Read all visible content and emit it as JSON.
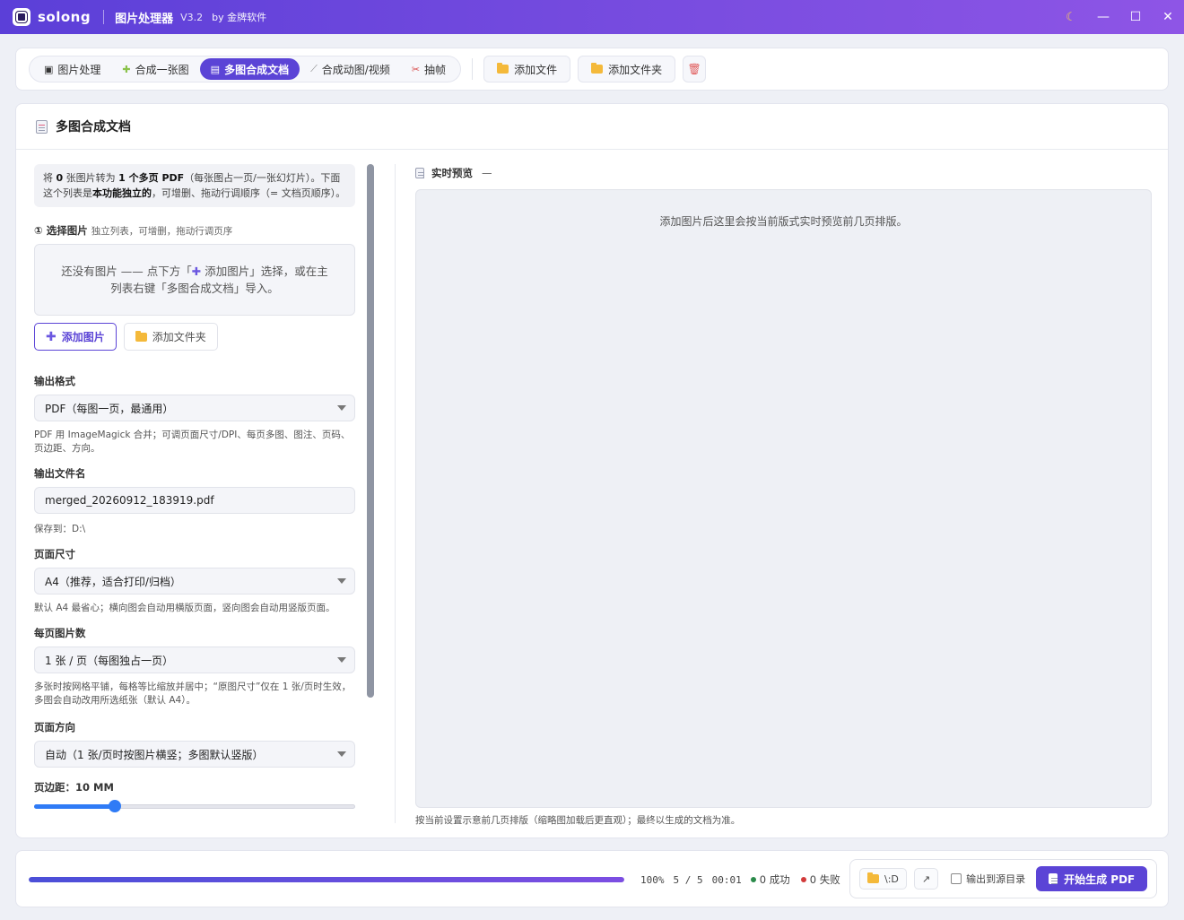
{
  "app": {
    "name": "solong",
    "title": "图片处理器",
    "version": "V3.2",
    "by": "by 金牌软件",
    "theme_icon": "moon-icon",
    "accent_color": "#5b44d6"
  },
  "window": {
    "minimize": "—",
    "maximize": "☐",
    "close": "✕"
  },
  "toolbar": {
    "tabs": [
      {
        "label": "图片处理",
        "icon": "image-icon",
        "glyph": "▣",
        "active": false
      },
      {
        "label": "合成一张图",
        "icon": "puzzle-icon",
        "glyph": "✚",
        "active": false
      },
      {
        "label": "多图合成文档",
        "icon": "document-icon",
        "glyph": "▤",
        "active": true
      },
      {
        "label": "合成动图/视频",
        "icon": "link-icon",
        "glyph": "⟋",
        "active": false
      },
      {
        "label": "抽帧",
        "icon": "scissors-icon",
        "glyph": "✂",
        "active": false
      }
    ],
    "add_file": "添加文件",
    "add_folder": "添加文件夹",
    "trash_glyph": "🗑"
  },
  "main": {
    "title": "多图合成文档",
    "info": {
      "p1": "将 ",
      "count_images": "0",
      "p2": " 张图片转为 ",
      "count_pdf": "1 个多页 PDF",
      "p3": "（每张图占一页/一张幻灯片）。下面这个列表是",
      "emph": "本功能独立的",
      "p4": "，可增删、拖动行调顺序（= 文档页顺序）。"
    },
    "select_images": {
      "title": "① 选择图片",
      "subtitle": "独立列表，可增删，拖动行调页序",
      "empty_text_1": "还没有图片 —— 点下方「",
      "empty_plus": "✚",
      "empty_text_2": " 添加图片」选择，或在主列表右键「多图合成文档」导入。",
      "add_images": "添加图片",
      "add_folder": "添加文件夹"
    },
    "output_format": {
      "label": "输出格式",
      "value": "PDF（每图一页，最通用）",
      "hint": "PDF 用 ImageMagick 合并；可调页面尺寸/DPI、每页多图、图注、页码、页边距、方向。"
    },
    "output_filename": {
      "label": "输出文件名",
      "value": "merged_20260912_183919.pdf",
      "save_to": "保存到：D:\\"
    },
    "page_size": {
      "label": "页面尺寸",
      "value": "A4（推荐，适合打印/归档）",
      "hint": "默认 A4 最省心；横向图会自动用横版页面，竖向图会自动用竖版页面。"
    },
    "images_per_page": {
      "label": "每页图片数",
      "value": "1 张 / 页（每图独占一页）",
      "hint": "多张时按网格平铺，每格等比缩放并居中；“原图尺寸”仅在 1 张/页时生效，多图会自动改用所选纸张（默认 A4）。"
    },
    "orientation": {
      "label": "页面方向",
      "value": "自动（1 张/页时按图片横竖；多图默认竖版）"
    },
    "margin": {
      "label": "页边距：",
      "value_text": "10 MM",
      "value": 10,
      "max": 40
    },
    "preview": {
      "title": "实时预览",
      "dash": "—",
      "placeholder": "添加图片后这里会按当前版式实时预览前几页排版。",
      "footer": "按当前设置示意前几页排版（缩略图加载后更直观）；最终以生成的文档为准。"
    }
  },
  "status": {
    "progress": 1.0,
    "percent": "100%",
    "count": "5 / 5",
    "time": "00:01",
    "success": "0 成功",
    "success_color": "#2a8a4a",
    "fail": "0 失败",
    "fail_color": "#d23a3a",
    "output_dir": "\\:D",
    "open_glyph": "↗",
    "output_to_source": "输出到源目录",
    "start": "开始生成 PDF"
  }
}
